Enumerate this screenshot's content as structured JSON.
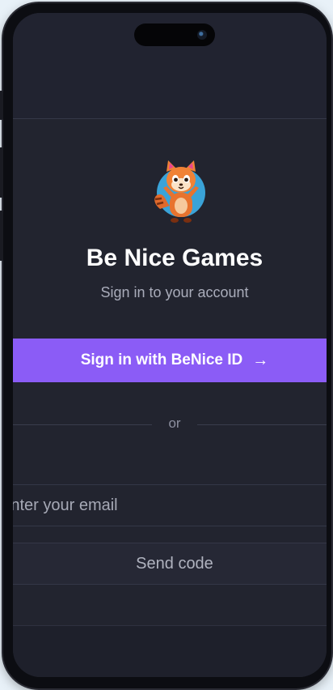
{
  "app": {
    "title": "Be Nice Games",
    "subtitle": "Sign in to your account"
  },
  "auth": {
    "primary_button_label": "Sign in with BeNice ID",
    "primary_button_icon": "arrow-right-icon",
    "divider_text": "or",
    "email_placeholder": "Enter your email",
    "send_code_label": "Send code"
  },
  "colors": {
    "background": "#22242f",
    "primary": "#8b5cf6",
    "text_primary": "#ffffff",
    "text_muted": "#a9acba"
  }
}
